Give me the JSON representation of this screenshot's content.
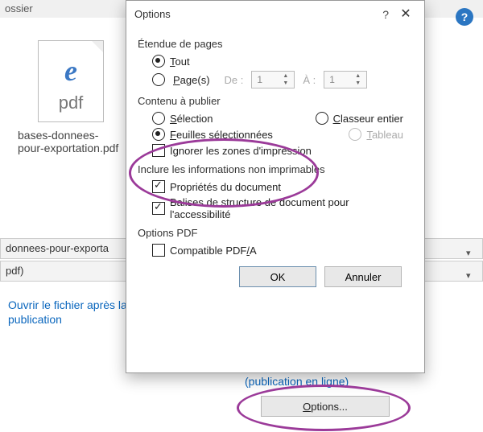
{
  "header": {
    "dossier": "ossier"
  },
  "file": {
    "icon_glyph": "e",
    "ext": "pdf",
    "caption": "bases-donnees-pour-exportation.pdf"
  },
  "rows": {
    "filename": "donnees-pour-exporta",
    "filetype": "pdf)"
  },
  "link": "Ouvrir le fichier après la publication",
  "below": {
    "hint": "(publication en ligne)",
    "options_prefix": "O",
    "options_rest": "ptions..."
  },
  "dialog": {
    "title": "Options",
    "sections": {
      "range": "Étendue de pages",
      "content": "Contenu à publier",
      "nonprint": "Inclure les informations non imprimables",
      "pdfopts": "Options PDF"
    },
    "range": {
      "all_u": "T",
      "all_rest": "out",
      "pages_u": "P",
      "pages_rest": "age(s)",
      "from": "De :",
      "to": "À :",
      "from_val": "1",
      "to_val": "1"
    },
    "content": {
      "sel_u": "S",
      "sel_rest": "élection",
      "wkbk_u": "C",
      "wkbk_rest": "lasseur entier",
      "sheets_u": "F",
      "sheets_rest": "euilles sélectionnées",
      "table_u": "T",
      "table_rest": "ableau",
      "ignore": "Ignorer les zones d'impression"
    },
    "nonprint": {
      "props": "Propriétés du document",
      "tags": "Balises de structure de document pour l'accessibilité"
    },
    "pdfopts": {
      "compat_pre": "Compatible PDF",
      "compat_u": "/",
      "compat_post": "A"
    },
    "buttons": {
      "ok": "OK",
      "cancel": "Annuler"
    }
  }
}
